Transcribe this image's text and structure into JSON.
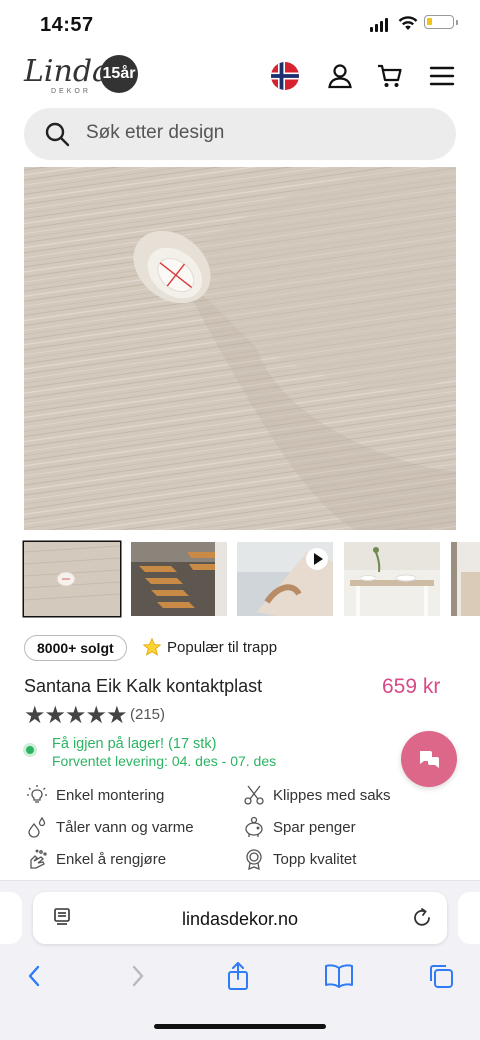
{
  "status": {
    "time": "14:57"
  },
  "header": {
    "logo_text": "Lindas",
    "logo_sub": "DEKOR",
    "logo_badge": "15år"
  },
  "search": {
    "placeholder": "Søk etter design"
  },
  "product": {
    "sold_badge": "8000+ solgt",
    "popular": "Populær til trapp",
    "title": "Santana Eik Kalk kontaktplast",
    "price": "659 kr",
    "rating_stars": "★★★★★",
    "reviews": "(215)",
    "stock": "Få igjen på lager! (17 stk)",
    "delivery": "Forventet levering: 04. des - 07. des",
    "features": [
      {
        "label": "Enkel montering",
        "icon": "bulb-icon"
      },
      {
        "label": "Klippes med saks",
        "icon": "scissors-icon"
      },
      {
        "label": "Tåler vann og varme",
        "icon": "drops-icon"
      },
      {
        "label": "Spar penger",
        "icon": "piggy-bank-icon"
      },
      {
        "label": "Enkel å rengjøre",
        "icon": "clean-hand-icon"
      },
      {
        "label": "Topp kvalitet",
        "icon": "medal-icon"
      }
    ]
  },
  "browser": {
    "url": "lindasdekor.no"
  },
  "colors": {
    "accent": "#d84b87",
    "chat": "#dc6788",
    "stock": "#2bb462"
  }
}
